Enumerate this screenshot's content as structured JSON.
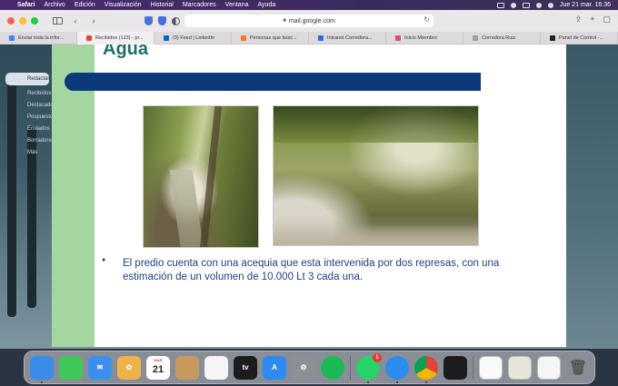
{
  "menubar": {
    "app": "Safari",
    "items": [
      "Archivo",
      "Edición",
      "Visualización",
      "Historial",
      "Marcadores",
      "Ventana",
      "Ayuda"
    ],
    "datetime": "Jue 21 mar.  16:36"
  },
  "toolbar": {
    "url": "mail.google.com"
  },
  "tabs": [
    {
      "label": "Enviar toda la infor...",
      "color": "#4285f4"
    },
    {
      "label": "Recibidos (123) - pr...",
      "color": "#ea4335"
    },
    {
      "label": "(9) Feed | LinkedIn",
      "color": "#0a66c2"
    },
    {
      "label": "Personas que búsc...",
      "color": "#f07a2a"
    },
    {
      "label": "Intranet Corredora...",
      "color": "#2a6fd6"
    },
    {
      "label": "Inicio Miembro",
      "color": "#e24a6e"
    },
    {
      "label": "Corredora Ruiz",
      "color": "#9aa0a6"
    },
    {
      "label": "Panel de Control -...",
      "color": "#222222"
    }
  ],
  "gmail_sidebar": {
    "compose": "Redactar",
    "items": [
      "Recibidos",
      "Destacados",
      "Pospuestos",
      "Enviados",
      "Borradores",
      "Más"
    ]
  },
  "slide": {
    "title": "Agua",
    "bullet": "El predio cuenta con una acequia que esta intervenida por dos represas, con una estimación de un volumen de 10.000 Lt 3 cada una."
  },
  "dock": {
    "apps": [
      {
        "name": "Finder",
        "color": "#3b8be8"
      },
      {
        "name": "Messages",
        "color": "#3fc75a"
      },
      {
        "name": "Mail",
        "color": "#3a8ff0"
      },
      {
        "name": "Photos",
        "color": "#f0b04a"
      },
      {
        "name": "Calendar",
        "color": "#ffffff",
        "month": "MAR",
        "day": "21"
      },
      {
        "name": "Contacts",
        "color": "#c69a5e"
      },
      {
        "name": "Reminders",
        "color": "#f5f5f5"
      },
      {
        "name": "TV",
        "color": "#1c1c1e",
        "label": "tv"
      },
      {
        "name": "App Store",
        "color": "#2e8cf0"
      },
      {
        "name": "System Settings",
        "color": "#8e8e93"
      },
      {
        "name": "Spotify",
        "color": "#1db954"
      },
      {
        "name": "WhatsApp",
        "color": "#25d366",
        "badge": "1"
      },
      {
        "name": "Safari",
        "color": "#2d8cf0"
      },
      {
        "name": "Chrome",
        "color": "#e9eaec"
      },
      {
        "name": "Voice Memos",
        "color": "#1c1c1e"
      }
    ]
  }
}
